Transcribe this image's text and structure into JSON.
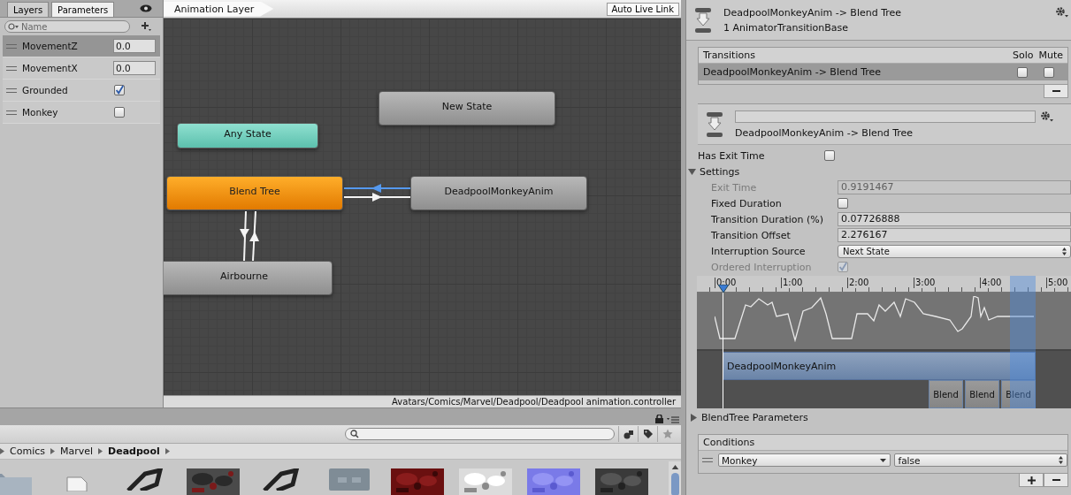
{
  "parameters_panel": {
    "tabs": [
      {
        "label": "Layers",
        "selected": false
      },
      {
        "label": "Parameters",
        "selected": true
      }
    ],
    "search": {
      "placeholder": "Name"
    },
    "parameters": [
      {
        "name": "MovementZ",
        "kind": "float",
        "value": "0.0",
        "selected": true
      },
      {
        "name": "MovementX",
        "kind": "float",
        "value": "0.0",
        "selected": false
      },
      {
        "name": "Grounded",
        "kind": "bool",
        "checked": true,
        "selected": false
      },
      {
        "name": "Monkey",
        "kind": "bool",
        "checked": false,
        "selected": false
      }
    ]
  },
  "graph": {
    "breadcrumb": "Animation Layer",
    "live_link_button": "Auto Live Link",
    "states": [
      {
        "name": "New State",
        "kind": "state"
      },
      {
        "name": "Any State",
        "kind": "any"
      },
      {
        "name": "Blend Tree",
        "kind": "default"
      },
      {
        "name": "DeadpoolMonkeyAnim",
        "kind": "state"
      },
      {
        "name": "Airbourne",
        "kind": "state"
      }
    ],
    "transitions": [
      {
        "selected": true
      },
      {
        "selected": false
      },
      {
        "selected": false
      },
      {
        "selected": false
      }
    ],
    "asset_path": "Avatars/Comics/Marvel/Deadpool/Deadpool animation.controller"
  },
  "project": {
    "breadcrumb": [
      {
        "label": "Comics",
        "selected": false
      },
      {
        "label": "Marvel",
        "selected": false
      },
      {
        "label": "Deadpool",
        "selected": true
      }
    ],
    "assets": [
      {
        "kind": "folder"
      },
      {
        "kind": "file"
      },
      {
        "kind": "unity"
      },
      {
        "kind": "picture"
      },
      {
        "kind": "unity"
      },
      {
        "kind": "tile"
      },
      {
        "kind": "picture"
      },
      {
        "kind": "picture"
      },
      {
        "kind": "picture"
      },
      {
        "kind": "picture"
      }
    ]
  },
  "inspector": {
    "title": "DeadpoolMonkeyAnim -> Blend Tree",
    "subtitle": "1 AnimatorTransitionBase",
    "transitions_list": {
      "header": "Transitions",
      "solo_header": "Solo",
      "mute_header": "Mute",
      "rows": [
        {
          "name": "DeadpoolMonkeyAnim -> Blend Tree",
          "selected": true,
          "solo": false,
          "mute": false
        }
      ]
    },
    "transition_caption": "DeadpoolMonkeyAnim -> Blend Tree",
    "properties": [
      {
        "kind": "checkbox",
        "label": "Has Exit Time",
        "checked": false,
        "disabled": false
      },
      {
        "kind": "foldout",
        "label": "Settings",
        "expanded": true,
        "children": [
          {
            "kind": "number",
            "label": "Exit Time",
            "value": "0.9191467",
            "disabled": true
          },
          {
            "kind": "checkbox",
            "label": "Fixed Duration",
            "checked": false,
            "disabled": false
          },
          {
            "kind": "number",
            "label": "Transition Duration (%)",
            "value": "0.07726888",
            "disabled": false
          },
          {
            "kind": "number",
            "label": "Transition Offset",
            "value": "2.276167",
            "disabled": false
          },
          {
            "kind": "dropdown",
            "label": "Interruption Source",
            "value": "Next State",
            "disabled": false
          },
          {
            "kind": "checkbox",
            "label": "Ordered Interruption",
            "checked": true,
            "disabled": true
          }
        ]
      }
    ],
    "timeline": {
      "ticks": [
        "0:00",
        "1:00",
        "2:00",
        "3:00",
        "4:00",
        "5:00"
      ],
      "clip": "DeadpoolMonkeyAnim",
      "blends": [
        "Blend",
        "Blend",
        "Blend"
      ]
    },
    "blend_tree_parameters": {
      "label": "BlendTree Parameters",
      "expanded": false
    },
    "conditions": {
      "header": "Conditions",
      "rows": [
        {
          "parameter": "Monkey",
          "value": "false"
        }
      ]
    }
  }
}
